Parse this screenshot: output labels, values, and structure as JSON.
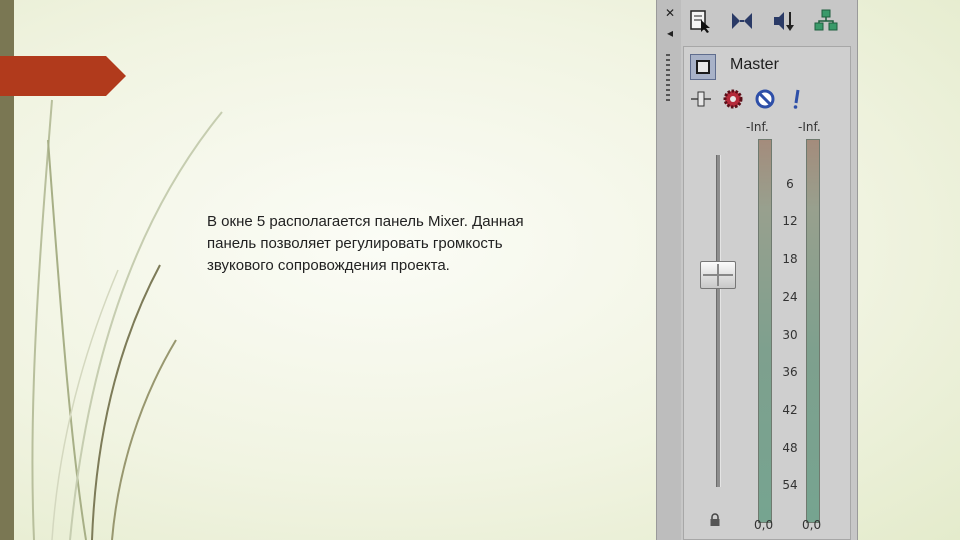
{
  "slide": {
    "text_lines": [
      "В окне 5 располагается панель Mixer. Данная",
      "панель позволяет регулировать громкость",
      "звукового сопровождения проекта."
    ]
  },
  "mixer": {
    "side_strip": {
      "close_glyph": "✕",
      "pin_glyph": "◂"
    },
    "toolbar_icons": [
      "properties-icon",
      "insert-bus-icon",
      "downmix-icon",
      "routing-icon"
    ],
    "channel": {
      "name": "Master",
      "controls": [
        "insert-fx-icon",
        "fx-gear-icon",
        "mute-icon",
        "solo-icon"
      ],
      "peak_left": "-Inf.",
      "peak_right": "-Inf.",
      "scale": [
        "6",
        "12",
        "18",
        "24",
        "30",
        "36",
        "42",
        "48",
        "54"
      ],
      "value_left": "0,0",
      "value_right": "0,0"
    }
  },
  "colors": {
    "left_bar": "#7a7753",
    "arrow": "#b13a1c",
    "panel_bg": "#c7c7c7",
    "meter_green": "#76a490"
  }
}
